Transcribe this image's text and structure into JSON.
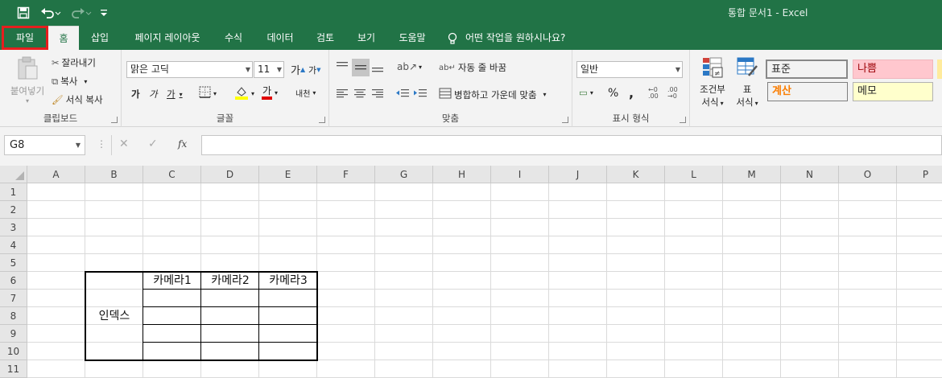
{
  "title_bar": {
    "title": "통합 문서1  -  Excel",
    "quick_access": [
      "save-icon",
      "undo-icon",
      "redo-icon",
      "customize-icon"
    ]
  },
  "tabs": [
    "파일",
    "홈",
    "삽입",
    "페이지 레이아웃",
    "수식",
    "데이터",
    "검토",
    "보기",
    "도움말"
  ],
  "tell_me": "어떤 작업을 원하시나요?",
  "ribbon": {
    "clipboard": {
      "paste": "붙여넣기",
      "cut": "잘라내기",
      "copy": "복사",
      "format_painter": "서식 복사",
      "label": "클립보드"
    },
    "font": {
      "font_name": "맑은 고딕",
      "font_size": "11",
      "bold": "가",
      "italic": "가",
      "underline": "가",
      "font_color_glyph": "가",
      "phonetic": "내천",
      "grow_glyph": "가",
      "shrink_glyph": "가",
      "label": "글꼴"
    },
    "alignment": {
      "wrap_text": "자동 줄 바꿈",
      "merge_center": "병합하고 가운데 맞춤",
      "label": "맞춤"
    },
    "number": {
      "format": "일반",
      "percent": "%",
      "comma": ",",
      "label": "표시 형식"
    },
    "styles": {
      "conditional_format": [
        "조건부",
        "서식"
      ],
      "table_format": [
        "표",
        "서식"
      ],
      "cells": [
        {
          "text": "표준",
          "bg": "#ffffff",
          "fg": "#000000"
        },
        {
          "text": "나쁨",
          "bg": "#ffc7ce",
          "fg": "#9c0006"
        },
        {
          "text": "계산",
          "bg": "#f2f2f2",
          "fg": "#fa7d00"
        },
        {
          "text": "메모",
          "bg": "#ffffcc",
          "fg": "#000000"
        }
      ]
    }
  },
  "formula_bar": {
    "name_box": "G8",
    "fx": "fx",
    "formula": ""
  },
  "grid": {
    "columns": [
      "A",
      "B",
      "C",
      "D",
      "E",
      "F",
      "G",
      "H",
      "I",
      "J",
      "K",
      "L",
      "M",
      "N",
      "O",
      "P"
    ],
    "rows": [
      "1",
      "2",
      "3",
      "4",
      "5",
      "6",
      "7",
      "8",
      "9",
      "10",
      "11"
    ],
    "cells": {
      "C6": "카메라1",
      "D6": "카메라2",
      "E6": "카메라3",
      "B8": "인덱스"
    }
  },
  "colors": {
    "excel_green": "#217346",
    "highlight_red": "#e61e1e"
  }
}
